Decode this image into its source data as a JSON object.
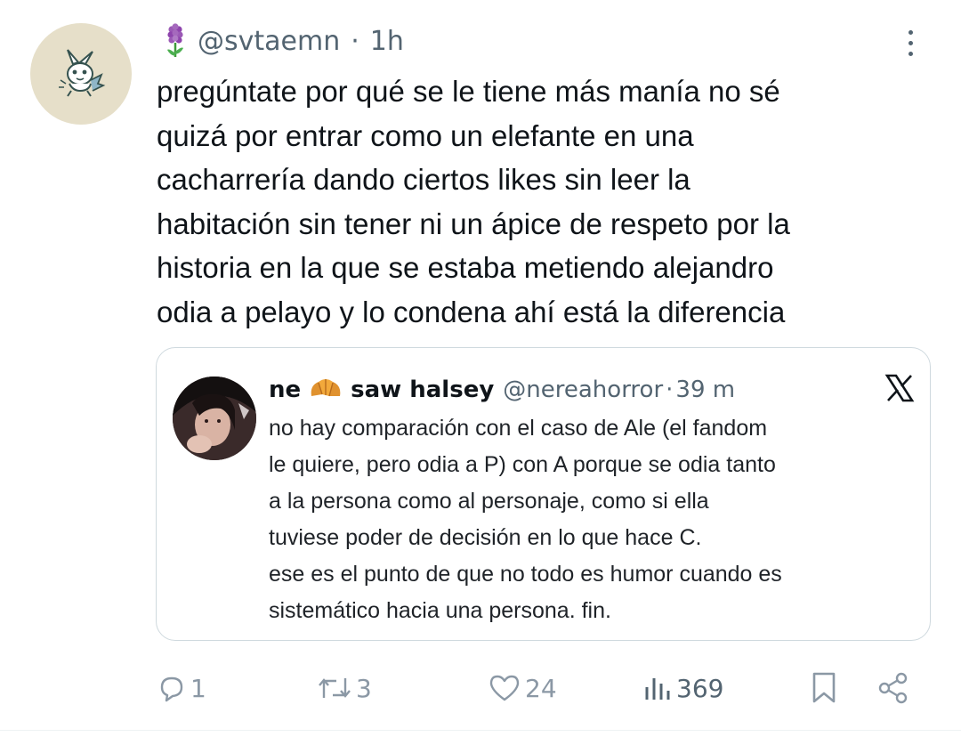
{
  "tweet": {
    "handle": "@svtaemn",
    "separator": "·",
    "time": "1h",
    "text_lines": [
      "pregúntate por qué se le tiene más manía no sé",
      "quizá por entrar como un elefante en una",
      "cacharrería dando ciertos likes sin leer la",
      "habitación sin tener ni un ápice de respeto por la",
      "historia en la que se estaba metiendo alejandro",
      "odia a pelayo y lo condena ahí está la diferencia"
    ]
  },
  "quote": {
    "name_part1": "ne",
    "name_part2": "saw halsey",
    "handle": "@nereahorror",
    "separator": "·",
    "time": "39 m",
    "text_lines": [
      "no hay comparación con el caso de Ale (el fandom",
      "le quiere, pero odia a P) con A porque se odia tanto",
      "a la persona como al personaje, como si ella",
      "tuviese poder de decisión en lo que hace C.",
      "ese es el punto de que no todo es humor cuando es",
      "sistemático hacia una persona. fin."
    ]
  },
  "actions": {
    "replies": "1",
    "reposts": "3",
    "likes": "24",
    "views": "369"
  },
  "icons": {
    "avatar": "pikachu-sketch-avatar",
    "emoji_handle": "hyacinth-flower-icon",
    "emoji_quote": "croissant-icon",
    "quote_logo": "x-logo-icon"
  },
  "colors": {
    "text": "#0f1419",
    "secondary": "#536471",
    "action_icons": "#8b98a5",
    "border": "#cfd9de"
  }
}
